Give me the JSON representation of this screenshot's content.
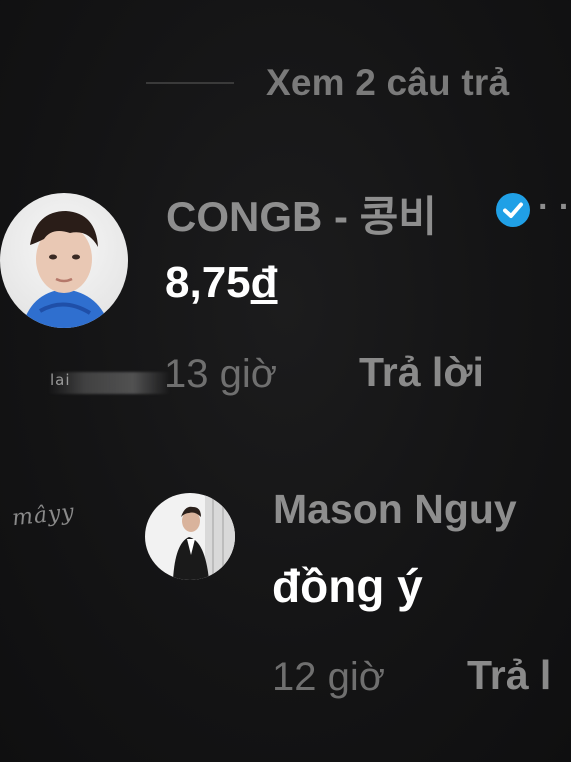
{
  "thread": {
    "view_replies_label": "Xem 2 câu trả"
  },
  "comments": [
    {
      "username": "CONGB - 콩비",
      "verified": true,
      "trailing": "· ·",
      "text": "8,75đ",
      "time": "13 giờ",
      "reply_label": "Trả lời"
    },
    {
      "username": "Mason Nguy",
      "text": "đồng ý",
      "time": "12 giờ",
      "reply_label": "Trả l"
    }
  ],
  "overlays": {
    "lai_text": "lai",
    "watermark": "mâyy"
  },
  "colors": {
    "background": "#121212",
    "verified_badge": "#20a0e6",
    "text_primary": "#ffffff",
    "text_secondary": "#8e8e8e"
  }
}
